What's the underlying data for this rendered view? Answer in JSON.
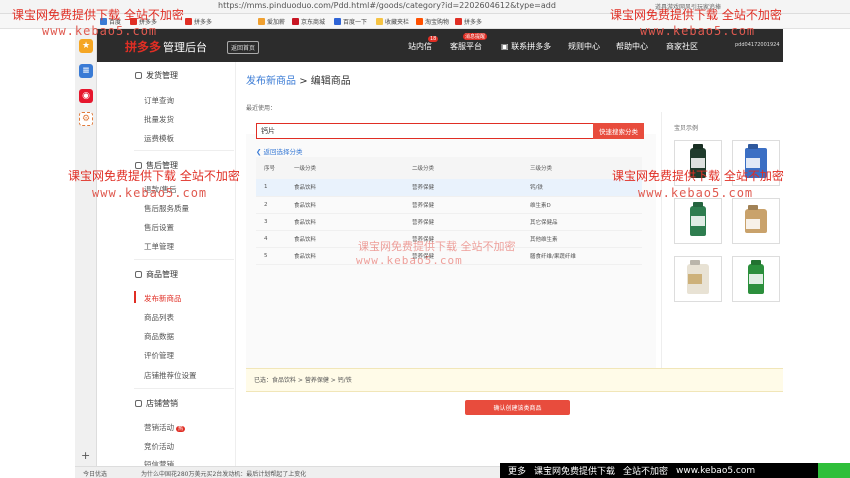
{
  "browser": {
    "url": "https://mms.pinduoduo.com/Pdd.html#/goods/category?id=2202604612&type=add",
    "right_text": "道具游戏网风引玩家追捧",
    "bookmarks": [
      "百度",
      "拼多多",
      "拼多多",
      "爱加薪",
      "京东商城",
      "百度一下",
      "收藏夹栏",
      "淘宝购物",
      "拼多多"
    ]
  },
  "header": {
    "logo": "拼多多",
    "logo_suffix": "管理后台",
    "back_home": "返回首页",
    "nav": [
      "站内信",
      "客服平台",
      "联系拼多多",
      "规则中心",
      "帮助中心",
      "商家社区"
    ],
    "msg_badge": "18",
    "service_badge": "消息提醒",
    "account": "pdd04172001924"
  },
  "menu": {
    "groups": [
      {
        "title": "发货管理",
        "items": [
          "订单查询",
          "批量发货",
          "运费模板"
        ]
      },
      {
        "title": "售后管理",
        "items": [
          "退款/售后",
          "售后服务质量",
          "售后设置",
          "工单管理"
        ]
      },
      {
        "title": "商品管理",
        "items": [
          "发布新商品",
          "商品列表",
          "商品数据",
          "评价管理",
          "店铺推荐位设置"
        ]
      },
      {
        "title": "店铺营销",
        "items": [
          "营销活动",
          "竞价活动",
          "短信营销"
        ]
      }
    ],
    "active_item": "发布新商品",
    "badge": "热"
  },
  "content": {
    "crumb_link": "发布新商品",
    "crumb_sep": ">",
    "crumb_current": "编辑商品",
    "recent_label": "最近使用：",
    "search_value": "钙片",
    "search_button": "快速搜索分类",
    "back_link": "返回选择分类",
    "table": {
      "headers": [
        "序号",
        "一级分类",
        "二级分类",
        "三级分类"
      ],
      "rows": [
        [
          "1",
          "食品饮料",
          "营养保健",
          "钙/铁"
        ],
        [
          "2",
          "食品饮料",
          "营养保健",
          "维生素D"
        ],
        [
          "3",
          "食品饮料",
          "营养保健",
          "其它保健品"
        ],
        [
          "4",
          "食品饮料",
          "营养保健",
          "其他维生素"
        ],
        [
          "5",
          "食品饮料",
          "营养保健",
          "膳食纤维/果蔬纤维"
        ]
      ]
    },
    "example_title": "宝贝示例",
    "chosen": "已选：食品饮料 > 营养保健 > 钙/铁",
    "confirm_button": "确认创建该类商品"
  },
  "statusbar": {
    "left": "今日优选",
    "news": "为什么中国花280万美元买2台发动机：最后计划帮起了上变化"
  },
  "watermark": {
    "text": "课宝网免费提供下载 全站不加密",
    "url": "www.kebao5.com",
    "center_text": "课宝网免费提供下载 全站不加密",
    "band": [
      "更多",
      "课宝网免费提供下载",
      "全站不加密",
      "www.kebao5.com"
    ]
  },
  "colors": {
    "accent": "#e02e24",
    "link": "#3a7bd5",
    "header_bg": "#2c2c2c",
    "selected_row": "#e9f2fc"
  },
  "icons": [
    "star-icon",
    "list-icon",
    "weibo-icon",
    "settings-icon",
    "plus-icon",
    "chevron-left-icon"
  ]
}
